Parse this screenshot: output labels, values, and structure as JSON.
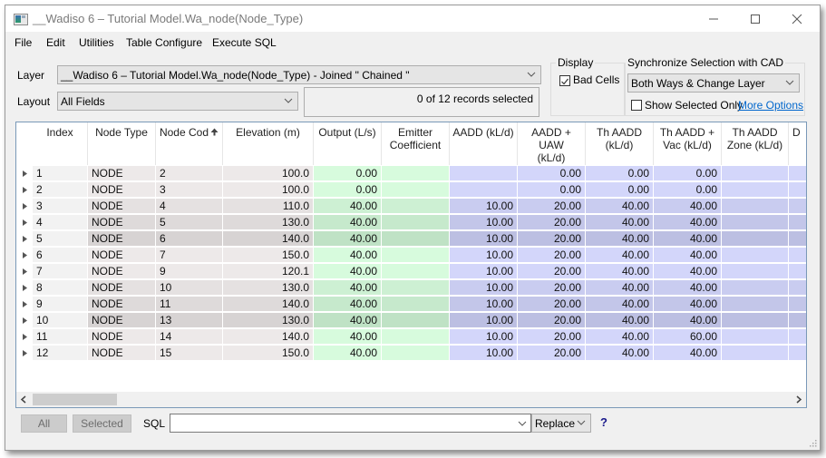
{
  "window": {
    "title": "__Wadiso 6 – Tutorial Model.Wa_node(Node_Type)",
    "controls": [
      "minimize",
      "maximize",
      "close"
    ]
  },
  "menu": [
    "File",
    "Edit",
    "Utilities",
    "Table Configure",
    "Execute SQL"
  ],
  "layer": {
    "label": "Layer",
    "value": "__Wadiso 6 – Tutorial Model.Wa_node(Node_Type) - Joined \" Chained \""
  },
  "layout": {
    "label": "Layout",
    "value": "All Fields"
  },
  "records_status": "0 of 12 records selected",
  "display": {
    "group_title": "Display",
    "bad_cells_label": "Bad Cells",
    "bad_cells_checked": true
  },
  "sync": {
    "group_title": "Synchronize Selection with CAD",
    "value": "Both Ways & Change Layer",
    "show_selected_only_label": "Show Selected Only",
    "show_selected_only_checked": false,
    "more_options_link": "More Options"
  },
  "table": {
    "columns": [
      {
        "key": "index",
        "label": "Index",
        "align": "left",
        "group": "gray"
      },
      {
        "key": "node_type",
        "label": "Node Type",
        "align": "left",
        "group": "gray"
      },
      {
        "key": "node_code",
        "label": "Node Cod",
        "align": "left",
        "group": "gray",
        "sorted": "ascending"
      },
      {
        "key": "elevation",
        "label": "Elevation (m)",
        "align": "right",
        "group": "gray"
      },
      {
        "key": "output",
        "label": "Output (L/s)",
        "align": "right",
        "group": "green"
      },
      {
        "key": "emitter",
        "label": "Emitter\nCoefficient",
        "align": "right",
        "group": "green"
      },
      {
        "key": "aadd",
        "label": "AADD (kL/d)",
        "align": "right",
        "group": "blue"
      },
      {
        "key": "aadd_uaw",
        "label": "AADD + UAW\n(kL/d)",
        "align": "right",
        "group": "blue"
      },
      {
        "key": "th_aadd",
        "label": "Th AADD\n(kL/d)",
        "align": "right",
        "group": "blue"
      },
      {
        "key": "th_aadd_vac",
        "label": "Th AADD +\nVac (kL/d)",
        "align": "right",
        "group": "blue"
      },
      {
        "key": "th_aadd_zone",
        "label": "Th AADD\nZone (kL/d)",
        "align": "right",
        "group": "blue"
      },
      {
        "key": "partial",
        "label": "D",
        "align": "right",
        "group": "blue"
      }
    ],
    "rows": [
      {
        "index": "1",
        "node_type": "NODE",
        "node_code": "2",
        "elevation": "100.0",
        "output": "0.00",
        "emitter": "",
        "aadd": "",
        "aadd_uaw": "0.00",
        "th_aadd": "0.00",
        "th_aadd_vac": "0.00",
        "th_aadd_zone": "",
        "partial": ""
      },
      {
        "index": "2",
        "node_type": "NODE",
        "node_code": "3",
        "elevation": "100.0",
        "output": "0.00",
        "emitter": "",
        "aadd": "",
        "aadd_uaw": "0.00",
        "th_aadd": "0.00",
        "th_aadd_vac": "0.00",
        "th_aadd_zone": "",
        "partial": ""
      },
      {
        "index": "3",
        "node_type": "NODE",
        "node_code": "4",
        "elevation": "110.0",
        "output": "40.00",
        "emitter": "",
        "aadd": "10.00",
        "aadd_uaw": "20.00",
        "th_aadd": "40.00",
        "th_aadd_vac": "40.00",
        "th_aadd_zone": "",
        "partial": ""
      },
      {
        "index": "4",
        "node_type": "NODE",
        "node_code": "5",
        "elevation": "130.0",
        "output": "40.00",
        "emitter": "",
        "aadd": "10.00",
        "aadd_uaw": "20.00",
        "th_aadd": "40.00",
        "th_aadd_vac": "40.00",
        "th_aadd_zone": "",
        "partial": ""
      },
      {
        "index": "5",
        "node_type": "NODE",
        "node_code": "6",
        "elevation": "140.0",
        "output": "40.00",
        "emitter": "",
        "aadd": "10.00",
        "aadd_uaw": "20.00",
        "th_aadd": "40.00",
        "th_aadd_vac": "40.00",
        "th_aadd_zone": "",
        "partial": ""
      },
      {
        "index": "6",
        "node_type": "NODE",
        "node_code": "7",
        "elevation": "150.0",
        "output": "40.00",
        "emitter": "",
        "aadd": "10.00",
        "aadd_uaw": "20.00",
        "th_aadd": "40.00",
        "th_aadd_vac": "40.00",
        "th_aadd_zone": "",
        "partial": ""
      },
      {
        "index": "7",
        "node_type": "NODE",
        "node_code": "9",
        "elevation": "120.1",
        "output": "40.00",
        "emitter": "",
        "aadd": "10.00",
        "aadd_uaw": "20.00",
        "th_aadd": "40.00",
        "th_aadd_vac": "40.00",
        "th_aadd_zone": "",
        "partial": ""
      },
      {
        "index": "8",
        "node_type": "NODE",
        "node_code": "10",
        "elevation": "130.0",
        "output": "40.00",
        "emitter": "",
        "aadd": "10.00",
        "aadd_uaw": "20.00",
        "th_aadd": "40.00",
        "th_aadd_vac": "40.00",
        "th_aadd_zone": "",
        "partial": ""
      },
      {
        "index": "9",
        "node_type": "NODE",
        "node_code": "11",
        "elevation": "140.0",
        "output": "40.00",
        "emitter": "",
        "aadd": "10.00",
        "aadd_uaw": "20.00",
        "th_aadd": "40.00",
        "th_aadd_vac": "40.00",
        "th_aadd_zone": "",
        "partial": ""
      },
      {
        "index": "10",
        "node_type": "NODE",
        "node_code": "13",
        "elevation": "130.0",
        "output": "40.00",
        "emitter": "",
        "aadd": "10.00",
        "aadd_uaw": "20.00",
        "th_aadd": "40.00",
        "th_aadd_vac": "40.00",
        "th_aadd_zone": "",
        "partial": ""
      },
      {
        "index": "11",
        "node_type": "NODE",
        "node_code": "14",
        "elevation": "140.0",
        "output": "40.00",
        "emitter": "",
        "aadd": "10.00",
        "aadd_uaw": "20.00",
        "th_aadd": "40.00",
        "th_aadd_vac": "60.00",
        "th_aadd_zone": "",
        "partial": ""
      },
      {
        "index": "12",
        "node_type": "NODE",
        "node_code": "15",
        "elevation": "150.0",
        "output": "40.00",
        "emitter": "",
        "aadd": "10.00",
        "aadd_uaw": "20.00",
        "th_aadd": "40.00",
        "th_aadd_vac": "40.00",
        "th_aadd_zone": "",
        "partial": ""
      }
    ],
    "shade_colors": {
      "gray": [
        "#ede9e9",
        "#ede9e9",
        "#e5e1e1",
        "#dedada",
        "#d7d3d3"
      ],
      "green": [
        "#d7fbdd",
        "#d7fbdd",
        "#cdf0d3",
        "#c6e9cc",
        "#bfe2c5"
      ],
      "blue": [
        "#d3d6fa",
        "#d3d6fa",
        "#c9ccf0",
        "#c3c6e9",
        "#bcbfe2"
      ],
      "index": [
        "#f2f2f2",
        "#f2f2f2",
        "#f2f2f2",
        "#f2f2f2",
        "#f2f2f2"
      ]
    }
  },
  "footer": {
    "all_button": "All",
    "selected_button": "Selected",
    "sql_label": "SQL",
    "sql_value": "",
    "mode_value": "Replace",
    "help_label": "?"
  }
}
